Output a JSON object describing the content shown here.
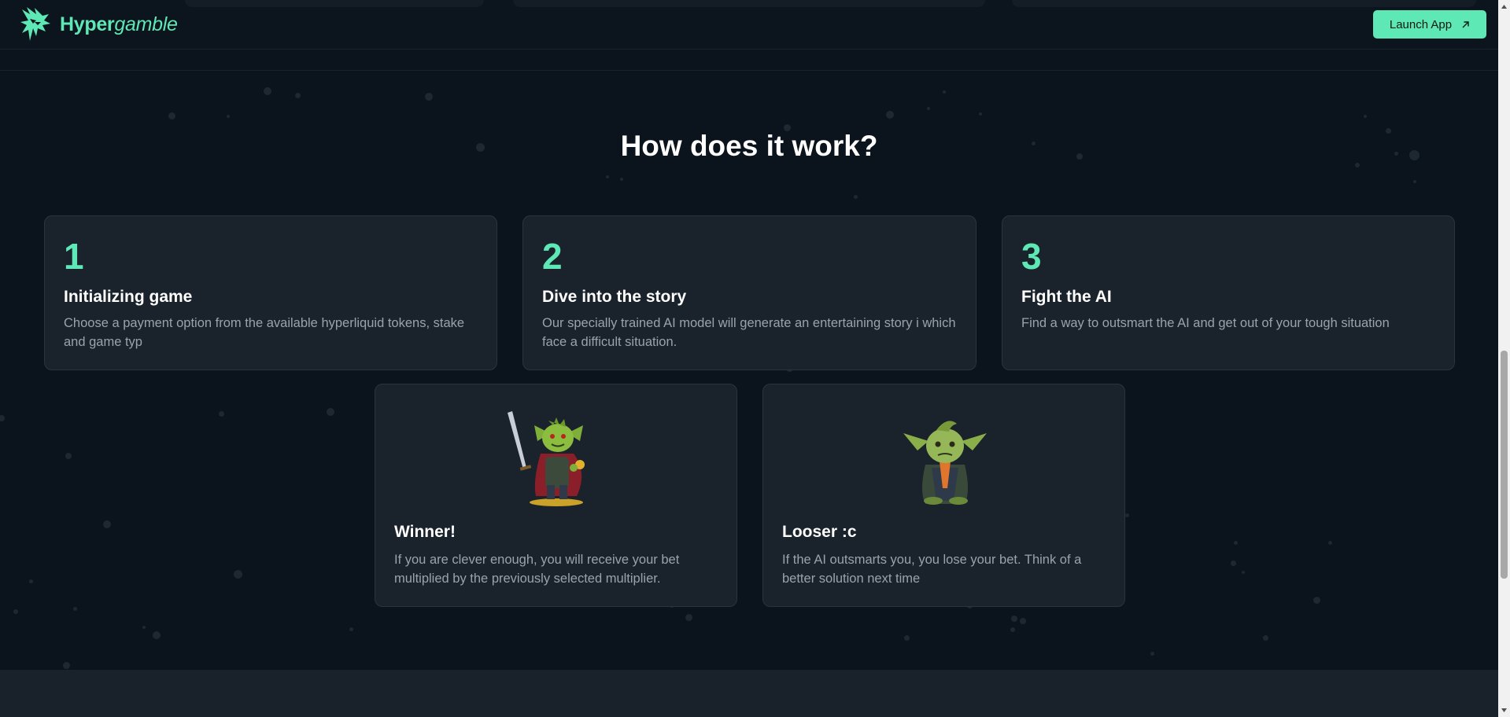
{
  "header": {
    "brand_strong": "Hyper",
    "brand_light": "gamble",
    "launch_label": "Launch App"
  },
  "section": {
    "title": "How does it work?"
  },
  "steps": [
    {
      "number": "1",
      "title": "Initializing game",
      "description": "Choose a payment option from the available hyperliquid tokens, stake and game typ"
    },
    {
      "number": "2",
      "title": "Dive into the story",
      "description": "Our specially trained AI model will generate an entertaining story i which face a difficult situation."
    },
    {
      "number": "3",
      "title": "Fight the AI",
      "description": "Find a way to outsmart the AI and get out of your tough situation"
    }
  ],
  "outcomes": [
    {
      "title": "Winner!",
      "description": "If you are clever enough, you will receive your bet multiplied by the previously selected multiplier."
    },
    {
      "title": "Looser :c",
      "description": "If the AI outsmarts you, you lose your bet. Think of a better solution next time"
    }
  ],
  "colors": {
    "accent": "#5ee8b5",
    "background": "#0b131c",
    "card": "#1a222c"
  },
  "icons": [
    "logo-icon",
    "arrow-up-right-icon",
    "goblin-winner-icon",
    "goblin-loser-icon"
  ]
}
